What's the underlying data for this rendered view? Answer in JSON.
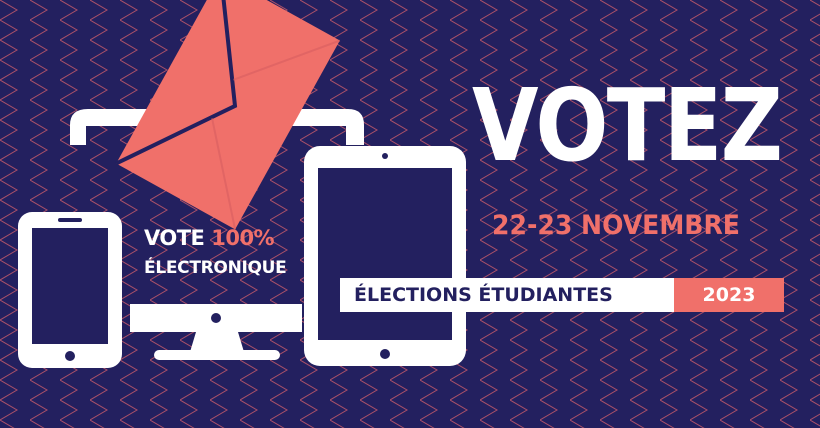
{
  "banner": {
    "vote_word": "VOTE",
    "vote_percent": "100%",
    "electronic_label": "ÉLECTRONIQUE",
    "headline": "VOTEZ",
    "dates": "22-23 NOVEMBRE",
    "elections_label": "ÉLECTIONS ÉTUDIANTES",
    "year": "2023"
  },
  "colors": {
    "background": "#23205f",
    "accent": "#f0706a",
    "white": "#ffffff"
  },
  "icons": [
    "envelope-icon",
    "desktop-monitor-icon",
    "smartphone-icon",
    "tablet-icon"
  ]
}
